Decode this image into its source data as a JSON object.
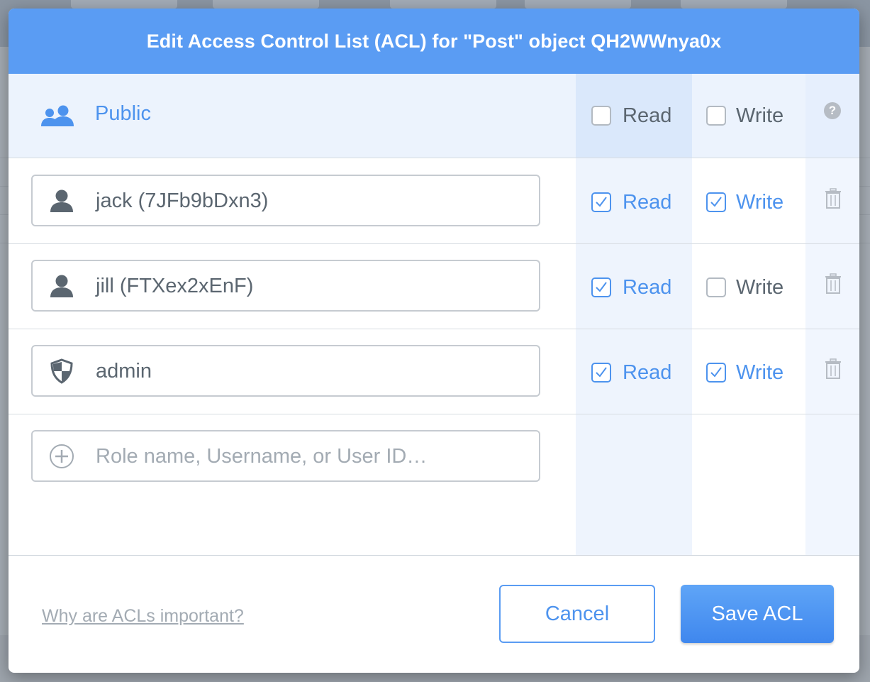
{
  "dialog": {
    "title": "Edit Access Control List (ACL) for \"Post\" object QH2WWnya0x"
  },
  "public_row": {
    "label": "Public",
    "icon": "users-icon",
    "read": {
      "label": "Read",
      "checked": false
    },
    "write": {
      "label": "Write",
      "checked": false
    },
    "help_icon": "question-circle-icon",
    "help_glyph": "?"
  },
  "entries": [
    {
      "name": "jack (7JFb9bDxn3)",
      "icon": "user-icon",
      "read": {
        "label": "Read",
        "checked": true
      },
      "write": {
        "label": "Write",
        "checked": true
      }
    },
    {
      "name": "jill (FTXex2xEnF)",
      "icon": "user-icon",
      "read": {
        "label": "Read",
        "checked": true
      },
      "write": {
        "label": "Write",
        "checked": false
      }
    },
    {
      "name": "admin",
      "icon": "shield-icon",
      "read": {
        "label": "Read",
        "checked": true
      },
      "write": {
        "label": "Write",
        "checked": true
      }
    }
  ],
  "new_entry": {
    "placeholder": "Role name, Username, or User ID…",
    "icon": "plus-circle-icon"
  },
  "footer": {
    "help_link": "Why are ACLs important?",
    "cancel_label": "Cancel",
    "save_label": "Save ACL"
  },
  "colors": {
    "accent": "#5a9cf3",
    "checked_text": "#4d93ee",
    "unchecked_text": "#5b6670"
  }
}
